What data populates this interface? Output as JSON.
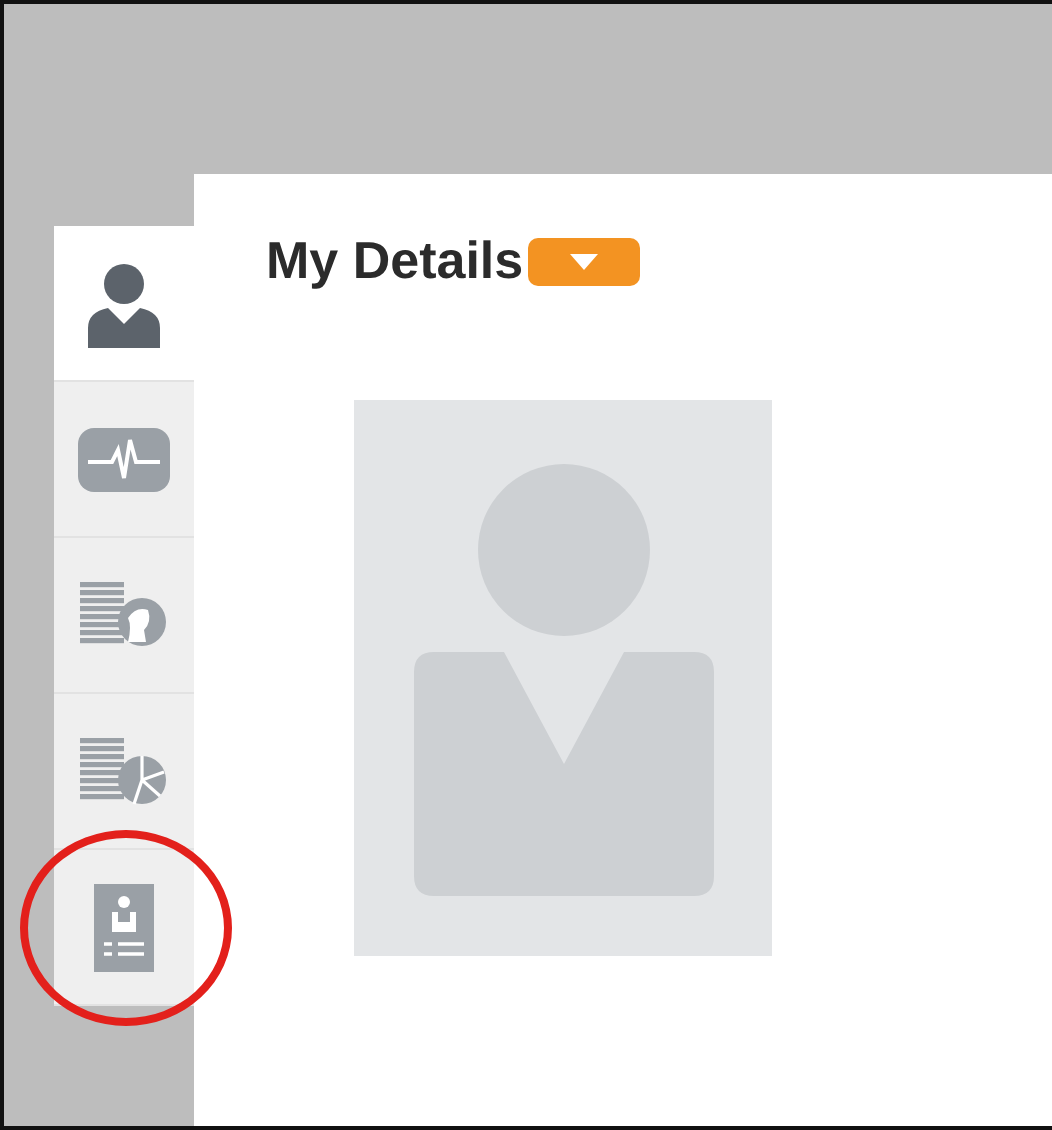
{
  "tabs": [
    {
      "kind": "person",
      "selected": true,
      "highlighted": false
    },
    {
      "kind": "pulse",
      "selected": false,
      "highlighted": false
    },
    {
      "kind": "list-head",
      "selected": false,
      "highlighted": false
    },
    {
      "kind": "list-pie",
      "selected": false,
      "highlighted": false
    },
    {
      "kind": "id-card",
      "selected": false,
      "highlighted": true
    }
  ],
  "panel": {
    "title": "My Details"
  }
}
